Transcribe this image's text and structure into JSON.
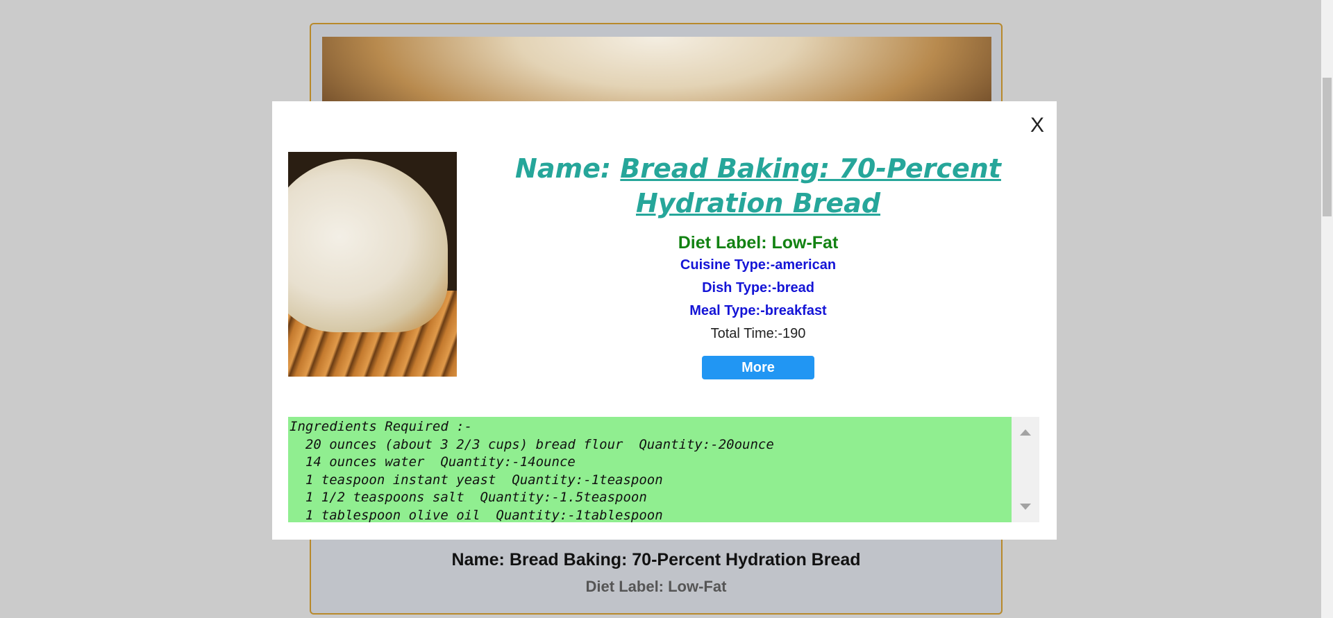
{
  "background_card": {
    "title": "Name: Bread Baking: 70-Percent Hydration Bread",
    "diet": "Diet Label: Low-Fat"
  },
  "modal": {
    "close_label": "X",
    "name_prefix": "Name: ",
    "name_link": "Bread Baking: 70-Percent Hydration Bread",
    "diet_label": "Diet Label: Low-Fat",
    "cuisine_type": "Cuisine Type:-american",
    "dish_type": "Dish Type:-bread",
    "meal_type": "Meal Type:-breakfast",
    "total_time": "Total Time:-190",
    "more_label": "More",
    "ingredients_header": "Ingredients Required :-",
    "ingredients": [
      "20 ounces (about 3 2/3 cups) bread flour  Quantity:-20ounce",
      "14 ounces water  Quantity:-14ounce",
      "1 teaspoon instant yeast  Quantity:-1teaspoon",
      "1 1/2 teaspoons salt  Quantity:-1.5teaspoon",
      "1 tablespoon olive oil  Quantity:-1tablespoon"
    ]
  },
  "colors": {
    "name": "#26a69a",
    "diet": "#128212",
    "meta": "#1414d6",
    "more_button": "#2196f3",
    "ingredients_bg": "#90ee90"
  },
  "icons": {
    "close": "close-icon",
    "scroll_up": "scroll-up-arrow-icon",
    "scroll_down": "scroll-down-arrow-icon"
  }
}
